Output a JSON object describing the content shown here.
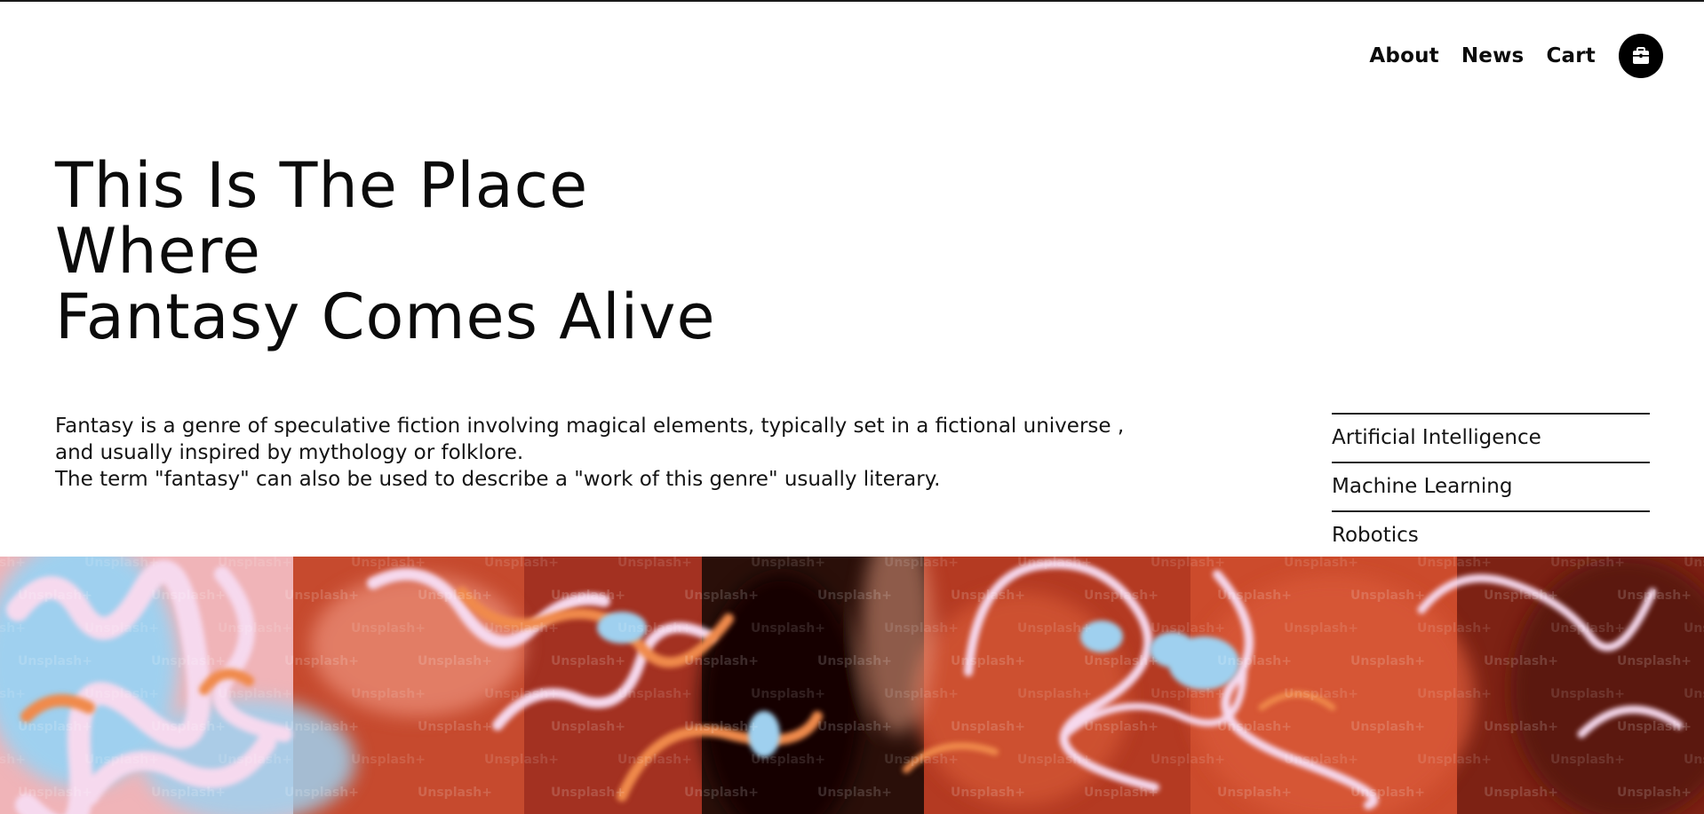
{
  "nav": {
    "links": [
      "About",
      "News",
      "Cart"
    ],
    "cart_icon": "shopping-bag-icon"
  },
  "hero": {
    "title_lines": [
      "This Is The Place",
      "Where",
      "Fantasy Comes Alive"
    ]
  },
  "intro": {
    "lines": [
      "Fantasy is a genre of speculative fiction involving magical elements, typically set in a fictional universe ,",
      "and usually inspired by mythology or folklore.",
      "The term \"fantasy\" can also be used to describe a \"work of this genre\" usually literary."
    ]
  },
  "topics": [
    "Artificial Intelligence",
    "Machine Learning",
    "Robotics"
  ],
  "banner": {
    "watermark": "Unsplash+",
    "colors": {
      "red": "#c23a1e",
      "orange": "#f08a4b",
      "blue": "#9fd0ef",
      "pink": "#f5d6ec",
      "dark": "#1b0c08"
    }
  }
}
